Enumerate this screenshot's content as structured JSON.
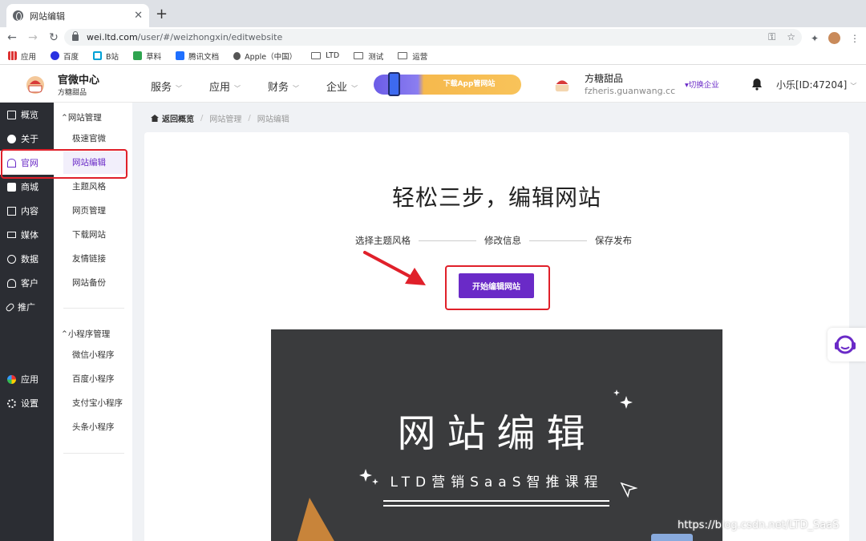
{
  "browser": {
    "tab_title": "网站编辑",
    "tab_close": "✕",
    "new_tab": "+",
    "url_host": "wei.ltd.com",
    "url_path": "/user/#/weizhongxin/editwebsite",
    "bookmarks": [
      "应用",
      "百度",
      "B站",
      "草料",
      "腾讯文档",
      "Apple（中国）",
      "LTD",
      "测试",
      "运营"
    ]
  },
  "header": {
    "brand_title": "官微中心",
    "brand_sub": "方糖甜品",
    "nav": [
      "服务",
      "应用",
      "财务",
      "企业"
    ],
    "promo_label": "下载App管网站",
    "company_name": "方糖甜品",
    "company_domain": "fzheris.guanwang.cc",
    "switch_label": "▾切换企业",
    "user_label": "小乐[ID:47204]"
  },
  "sidebar": {
    "items": [
      {
        "label": "概览",
        "icon": "monitor-icon"
      },
      {
        "label": "关于",
        "icon": "gear-flower-icon"
      },
      {
        "label": "官网",
        "icon": "home-icon"
      },
      {
        "label": "商城",
        "icon": "store-icon"
      },
      {
        "label": "内容",
        "icon": "document-icon"
      },
      {
        "label": "媒体",
        "icon": "video-icon"
      },
      {
        "label": "数据",
        "icon": "clock-icon"
      },
      {
        "label": "客户",
        "icon": "person-icon"
      },
      {
        "label": "推广",
        "icon": "paperclip-icon"
      },
      {
        "label": "应用",
        "icon": "apps-icon"
      },
      {
        "label": "设置",
        "icon": "settings-icon"
      }
    ]
  },
  "submenu": {
    "group1": "网站管理",
    "group1_items": [
      "极速官微",
      "网站编辑",
      "主题风格",
      "网页管理",
      "下载网站",
      "友情链接",
      "网站备份"
    ],
    "group2": "小程序管理",
    "group2_items": [
      "微信小程序",
      "百度小程序",
      "支付宝小程序",
      "头条小程序"
    ]
  },
  "breadcrumb": {
    "back": "返回概览",
    "level1": "网站管理",
    "level2": "网站编辑",
    "sep": "/"
  },
  "main": {
    "headline": "轻松三步，编辑网站",
    "steps": [
      "选择主题风格",
      "修改信息",
      "保存发布"
    ],
    "cta_label": "开始编辑网站",
    "preview_title": "网站编辑",
    "preview_subtitle": "LTD营销SaaS智推课程"
  },
  "watermark": "https://blog.csdn.net/LTD_SaaS",
  "colors": {
    "accent": "#6a2ac7",
    "sidebar_bg": "#2b2d33",
    "highlight": "#e0202a"
  }
}
